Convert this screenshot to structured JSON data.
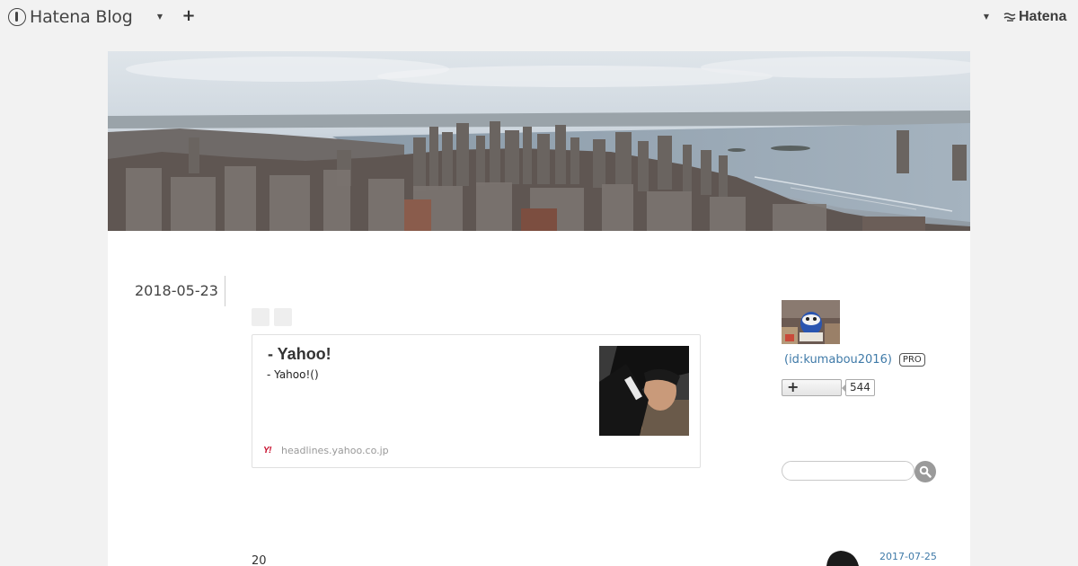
{
  "global_header": {
    "brand": "Hatena Blog",
    "hatena_brand": "Hatena",
    "icons": [
      "hatena-blog-logo-icon",
      "dropdown-caret-icon",
      "plus-icon",
      "hatena-logo-icon"
    ]
  },
  "entry": {
    "date": "2018-05-23",
    "embed": {
      "title": "- Yahoo!",
      "description": "- Yahoo!()",
      "source": "headlines.yahoo.co.jp",
      "source_icon_text": "Y!"
    },
    "next_snippet": "20"
  },
  "sidebar": {
    "profile": {
      "id_label": "(id:kumabou2016)",
      "badge": "PRO",
      "follow_label": "+",
      "follower_count": "544"
    },
    "search": {
      "placeholder": ""
    },
    "recent": {
      "date": "2017-07-25"
    }
  },
  "colors": {
    "page_bg": "#f2f2f2",
    "link": "#3f7aa8",
    "yahoo_red": "#c8102e"
  }
}
